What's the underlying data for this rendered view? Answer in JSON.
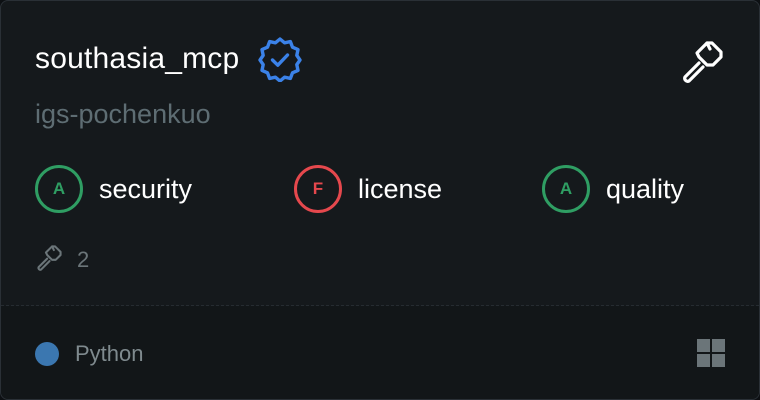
{
  "server": {
    "name": "southasia_mcp",
    "author": "igs-pochenkuo",
    "verified_icon": "verified-badge-icon",
    "tool_icon": "hammer-icon"
  },
  "grades": [
    {
      "letter": "A",
      "label": "security",
      "color": "#2f9e63"
    },
    {
      "letter": "F",
      "label": "license",
      "color": "#e5484d"
    },
    {
      "letter": "A",
      "label": "quality",
      "color": "#2f9e63"
    }
  ],
  "tools": {
    "count": "2",
    "icon": "hammer-icon"
  },
  "footer": {
    "language": "Python",
    "language_color": "#3b77b0",
    "os_icon": "windows-icon"
  }
}
